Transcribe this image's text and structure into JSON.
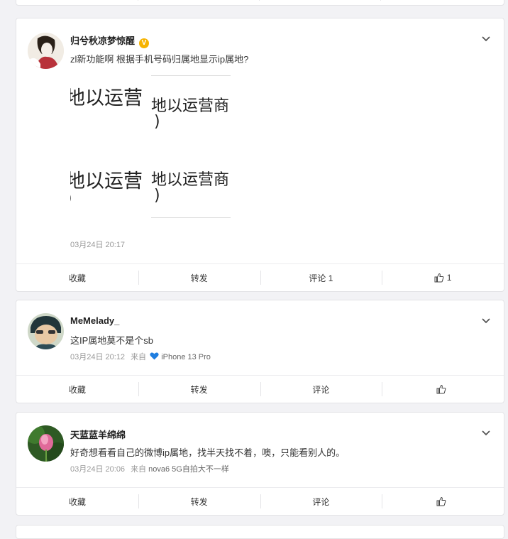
{
  "posts": [
    {
      "username": "归兮秋凉梦惊醒",
      "verified": true,
      "text": "zl新功能啊 根据手机号码归属地显示ip属地?",
      "image_text": [
        "地以运营",
        "地以运营商",
        ")",
        "地以运营",
        "地以运营商",
        ")"
      ],
      "date": "03月24日 20:17",
      "source_prefix": "",
      "device": "",
      "actions": {
        "favorite": "收藏",
        "repost": "转发",
        "comment": "评论 1",
        "like": "1"
      }
    },
    {
      "username": "MeMelady_",
      "verified": false,
      "text": "这IP属地莫不是个sb",
      "date": "03月24日 20:12",
      "source_prefix": "来自",
      "device": "iPhone 13 Pro",
      "actions": {
        "favorite": "收藏",
        "repost": "转发",
        "comment": "评论",
        "like": ""
      }
    },
    {
      "username": "天蓝蓝羊绵绵",
      "verified": false,
      "text": "好奇想看看自己的微博ip属地，找半天找不着，噢，只能看别人的。",
      "date": "03月24日 20:06",
      "source_prefix": "来自",
      "device": "nova6 5G自拍大不一样",
      "actions": {
        "favorite": "收藏",
        "repost": "转发",
        "comment": "评论",
        "like": ""
      }
    }
  ],
  "colors": {
    "background": "#f2f2f5",
    "verified_badge": "#f6b300",
    "heart": "#1f7ee0",
    "meta": "#999999"
  }
}
